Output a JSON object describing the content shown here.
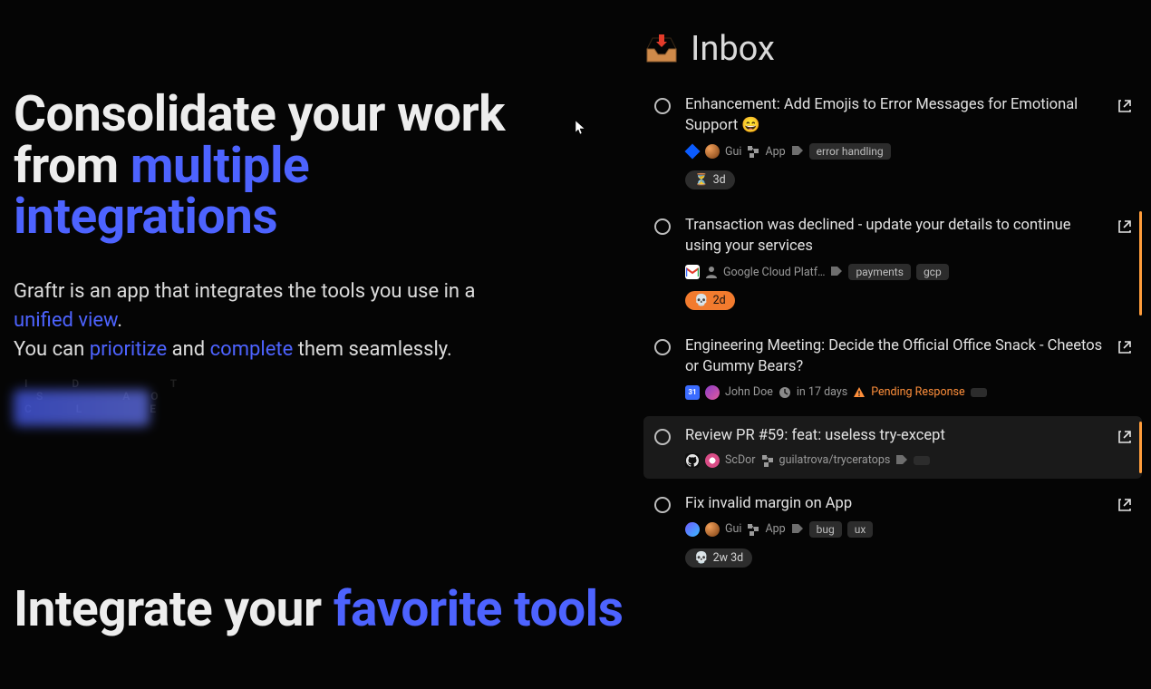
{
  "headline": {
    "line1": "Consolidate your work",
    "line2_prefix": "from ",
    "line2_accent": "multiple integrations"
  },
  "sub": {
    "l1_a": "Graftr is an app that integrates the tools you use in a ",
    "l1_accent": "unified view",
    "l1_b": ".",
    "l2_a": "You can ",
    "l2_accent1": "prioritize",
    "l2_b": " and ",
    "l2_accent2": "complete",
    "l2_c": " them seamlessly."
  },
  "headline2": {
    "prefix": "Integrate your ",
    "accent": "favorite tools"
  },
  "inbox": {
    "title": "Inbox",
    "items": [
      {
        "title": "Enhancement: Add Emojis to Error Messages for Emotional Support 😄",
        "source": "jira",
        "avatar": "gui",
        "author": "Gui",
        "project": "App",
        "tags": [
          "error handling"
        ],
        "age_emoji": "⏳",
        "age": "3d",
        "age_variant": "warn",
        "status": null,
        "due": null,
        "selected": false,
        "rightbar": false
      },
      {
        "title": "Transaction was declined - update your details to continue using your services",
        "source": "gmail",
        "avatar": "generic",
        "author": "Google Cloud Platf…",
        "project": null,
        "tags": [
          "payments",
          "gcp"
        ],
        "age_emoji": "💀",
        "age": "2d",
        "age_variant": "danger",
        "status": null,
        "due": null,
        "selected": false,
        "rightbar": true
      },
      {
        "title": "Engineering Meeting: Decide the Official Office Snack - Cheetos or Gummy Bears?",
        "source": "calendar",
        "avatar": "john",
        "author": "John Doe",
        "project": null,
        "tags": [],
        "age_emoji": null,
        "age": null,
        "age_variant": null,
        "status": "Pending Response",
        "due": "in 17 days",
        "selected": false,
        "rightbar": false
      },
      {
        "title": "Review PR #59: feat: useless try-except",
        "source": "github",
        "avatar": "scdor",
        "author": "ScDor",
        "project": "guilatrova/tryceratops",
        "tags": [],
        "age_emoji": null,
        "age": null,
        "age_variant": null,
        "status": null,
        "due": null,
        "selected": true,
        "rightbar": true
      },
      {
        "title": "Fix invalid margin on App",
        "source": "linear",
        "avatar": "gui",
        "author": "Gui",
        "project": "App",
        "tags": [
          "bug",
          "ux"
        ],
        "age_emoji": "💀",
        "age": "2w 3d",
        "age_variant": "dark",
        "status": null,
        "due": null,
        "selected": false,
        "rightbar": false
      }
    ]
  }
}
